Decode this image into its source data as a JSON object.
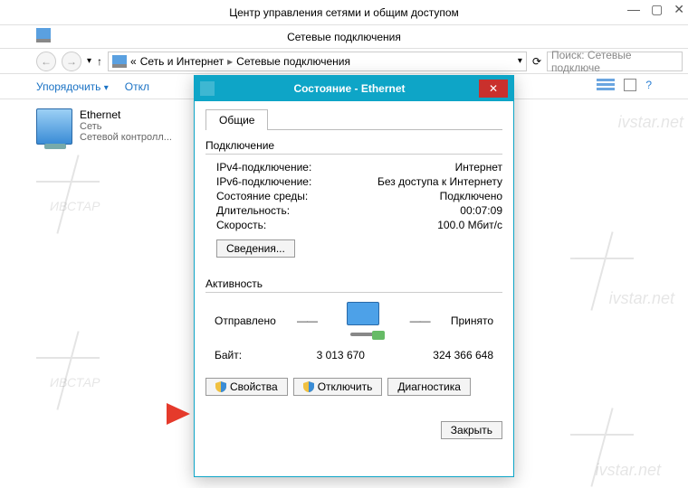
{
  "parentWindow": {
    "title": "Центр управления сетями и общим доступом"
  },
  "subWindow": {
    "title": "Сетевые подключения"
  },
  "breadcrumb": {
    "prefix": "«",
    "seg1": "Сеть и Интернет",
    "seg2": "Сетевые подключения"
  },
  "search": {
    "placeholder": "Поиск: Сетевые подключе"
  },
  "toolbar": {
    "organize": "Упорядочить",
    "disable": "Откл"
  },
  "netItem": {
    "name": "Ethernet",
    "line2": "Сеть",
    "line3": "Сетевой контролл..."
  },
  "dialog": {
    "title": "Состояние - Ethernet",
    "tab": "Общие",
    "connGroup": "Подключение",
    "ipv4Label": "IPv4-подключение:",
    "ipv4Value": "Интернет",
    "ipv6Label": "IPv6-подключение:",
    "ipv6Value": "Без доступа к Интернету",
    "mediaLabel": "Состояние среды:",
    "mediaValue": "Подключено",
    "durationLabel": "Длительность:",
    "durationValue": "00:07:09",
    "speedLabel": "Скорость:",
    "speedValue": "100.0 Мбит/с",
    "detailsBtn": "Сведения...",
    "activityGroup": "Активность",
    "sent": "Отправлено",
    "received": "Принято",
    "bytesLabel": "Байт:",
    "bytesSent": "3 013 670",
    "bytesRecv": "324 366 648",
    "propsBtn": "Свойства",
    "disableBtn": "Отключить",
    "diagBtn": "Диагностика",
    "closeBtn": "Закрыть"
  },
  "watermark": {
    "text": "ivstar.net",
    "brand": "ИВСТАР"
  }
}
